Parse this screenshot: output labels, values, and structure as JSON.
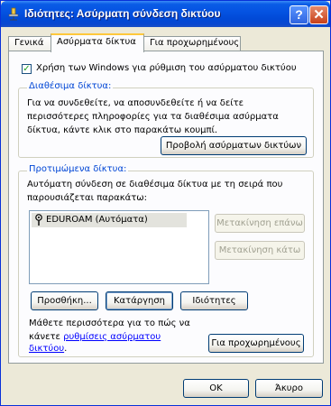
{
  "window": {
    "title": "Ιδιότητες: Ασύρματη σύνδεση δικτύου",
    "help_label": "?",
    "close_label": "✕"
  },
  "tabs": [
    {
      "label": "Γενικά"
    },
    {
      "label": "Ασύρματα δίκτυα",
      "active": true
    },
    {
      "label": "Για προχωρημένους"
    }
  ],
  "main": {
    "use_windows_checkbox": {
      "label": "Χρήση των Windows για ρύθμιση του ασύρματου δικτύου",
      "checked": true
    },
    "available": {
      "legend": "Διαθέσιμα δίκτυα:",
      "description_lines": [
        "Για να συνδεθείτε, να αποσυνδεθείτε ή να δείτε",
        "περισσότερες πληροφορίες για τα διαθέσιμα ασύρματα",
        "δίκτυα, κάντε κλικ στο παρακάτω κουμπί."
      ],
      "view_button": "Προβολή ασύρματων δικτύων"
    },
    "preferred": {
      "legend": "Προτιμώμενα δίκτυα:",
      "description_lines": [
        "Αυτόματη σύνδεση σε διαθέσιμα δίκτυα με τη σειρά που",
        "παρουσιάζεται παρακάτω:"
      ],
      "networks": [
        {
          "label": "EDUROAM (Αυτόματα)",
          "icon": "wireless-network-icon"
        }
      ],
      "move_up_button": "Μετακίνηση επάνω",
      "move_down_button": "Μετακίνηση κάτω",
      "add_button": "Προσθήκη...",
      "remove_button": "Κατάργηση",
      "properties_button": "Ιδιότητες"
    },
    "learn_more": {
      "text_line1": "Μάθετε περισσότερα για το πώς να",
      "text_line2_prefix": "κάνετε ",
      "link_part1": "ρυθμίσεις ασύρματου",
      "link_part2": "δικτύου",
      "text_suffix": "."
    },
    "advanced_button": "Για προχωρημένους"
  },
  "footer": {
    "ok_button": "OK",
    "cancel_button": "Άκυρο"
  },
  "colors": {
    "titlebar": "#0553e2",
    "window_bg": "#ece9d8",
    "legend": "#0046d5",
    "tab_highlight": "#ffc83c",
    "link": "#0000ff"
  }
}
